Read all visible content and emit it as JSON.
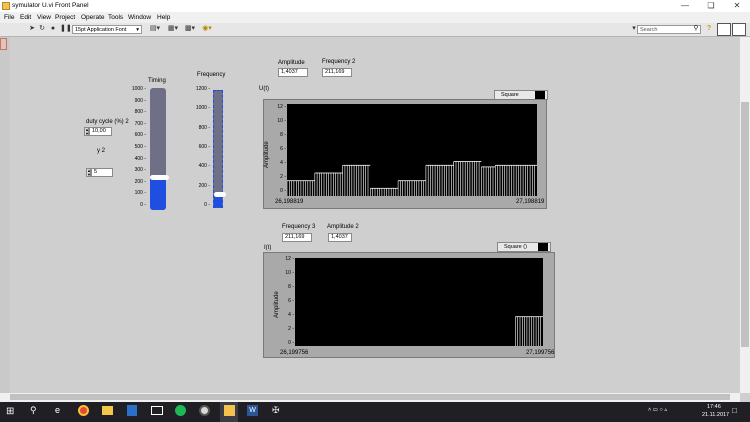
{
  "window": {
    "title": "symulator U.vi Front Panel"
  },
  "menu": [
    "File",
    "Edit",
    "View",
    "Project",
    "Operate",
    "Tools",
    "Window",
    "Help"
  ],
  "toolbar": {
    "font": "15pt Application Font",
    "search_placeholder": "Search"
  },
  "controls": {
    "duty_label": "duty cycle (%) 2",
    "duty_value": "10,00",
    "y_label": "y 2",
    "y_value": "5",
    "timing_label": "Timing",
    "frequency_label": "Frequency",
    "timing_fraction": 0.265,
    "frequency_fraction": 0.09,
    "timing_ticks": [
      "1000",
      "900",
      "800",
      "700",
      "600",
      "500",
      "400",
      "300",
      "200",
      "100",
      "0"
    ],
    "frequency_ticks": [
      "1200",
      "1000",
      "800",
      "600",
      "400",
      "200",
      "0"
    ]
  },
  "graph1": {
    "amplitude_label": "Amplitude",
    "amplitude_value": "1,4037",
    "frequency_label": "Frequency 2",
    "frequency_value": "211,169",
    "title": "U(t)",
    "legend": "Square",
    "ylabel": "Amplitude",
    "yticks": [
      "12",
      "10",
      "8",
      "6",
      "4",
      "2",
      "0"
    ],
    "xmin": "26,198819",
    "xmax": "27,198819"
  },
  "graph2": {
    "frequency_label": "Frequency 3",
    "frequency_value": "211,169",
    "amplitude_label": "Amplitude 2",
    "amplitude_value": "1,4037",
    "title": "I(t)",
    "legend": "Square ()",
    "ylabel": "Amplitude",
    "yticks": [
      "12",
      "10",
      "8",
      "6",
      "4",
      "2",
      "0"
    ],
    "xmin": "26,199756",
    "xmax": "27,199756"
  },
  "chart_data": [
    {
      "type": "line",
      "ylabel": "Amplitude",
      "ylim": [
        0,
        12
      ],
      "xlim": [
        "26,198819",
        "27,198819"
      ],
      "series": [
        {
          "levels": [
            2,
            2,
            3,
            3,
            4,
            4,
            1,
            1,
            2,
            2,
            4,
            4,
            4.5,
            4.5,
            3.8,
            4,
            4,
            4
          ]
        }
      ]
    },
    {
      "type": "line",
      "ylabel": "Amplitude",
      "ylim": [
        0,
        12
      ],
      "xlim": [
        "26,199756",
        "27,199756"
      ],
      "series": [
        {
          "levels": [
            0,
            0,
            0,
            0,
            0,
            0,
            0,
            0,
            0,
            0,
            0,
            0,
            0,
            0,
            0,
            0,
            4,
            4
          ]
        }
      ]
    }
  ],
  "taskbar": {
    "time": "17:46",
    "date": "21.11.2017"
  }
}
